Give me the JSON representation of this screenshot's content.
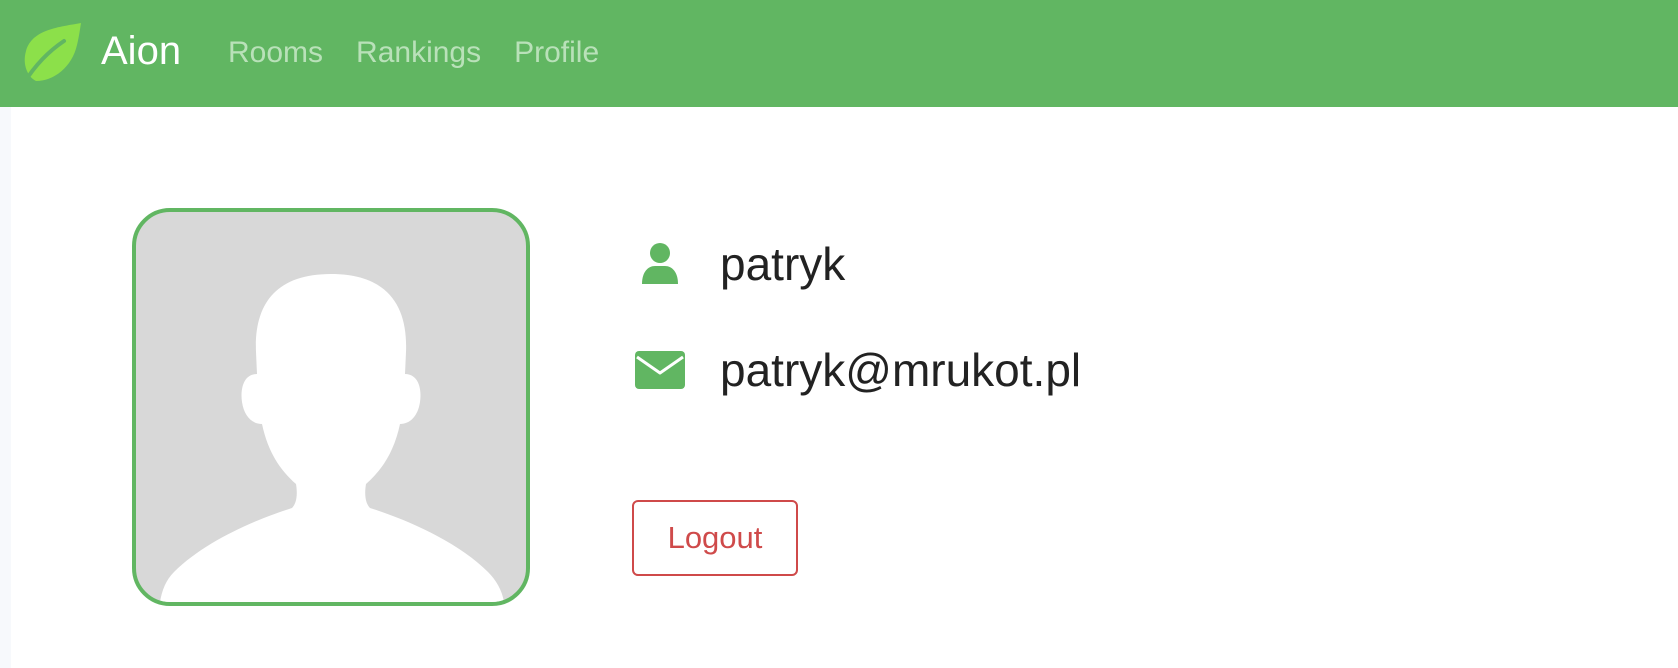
{
  "navbar": {
    "brand": "Aion",
    "logo_icon": "leaf-icon",
    "links": [
      {
        "label": "Rooms"
      },
      {
        "label": "Rankings"
      },
      {
        "label": "Profile"
      }
    ]
  },
  "profile": {
    "avatar_icon": "default-avatar-silhouette",
    "username_icon": "user-icon",
    "username": "patryk",
    "email_icon": "envelope-icon",
    "email": "patryk@mrukot.pl",
    "logout_label": "Logout"
  },
  "colors": {
    "accent_green": "#61b662",
    "logo_green": "#8ce04a",
    "nav_link": "#b9e1b9",
    "danger_red": "#cf4a4a",
    "avatar_bg": "#d8d8d8",
    "text": "#222222"
  }
}
